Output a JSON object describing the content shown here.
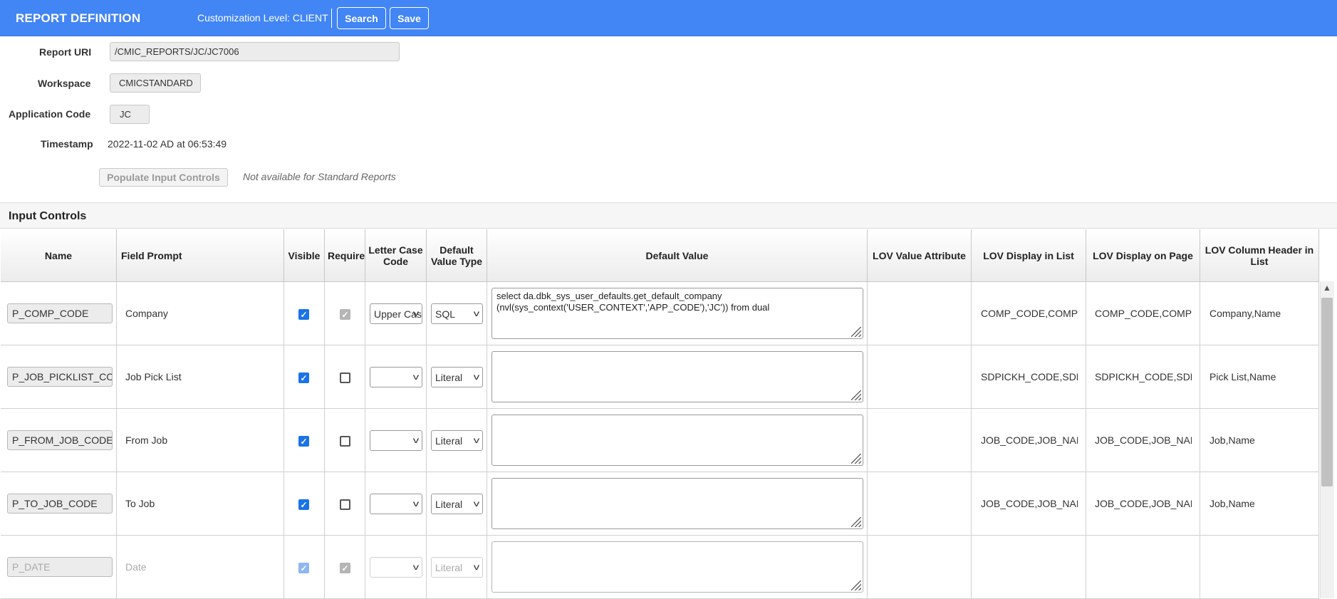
{
  "header": {
    "title": "REPORT DEFINITION",
    "customization_level": "Customization Level: CLIENT",
    "search_label": "Search",
    "save_label": "Save"
  },
  "form": {
    "report_uri_label": "Report URI",
    "report_uri_value": "/CMIC_REPORTS/JC/JC7006",
    "workspace_label": "Workspace",
    "workspace_value": "CMICSTANDARD",
    "application_code_label": "Application Code",
    "application_code_value": "JC",
    "timestamp_label": "Timestamp",
    "timestamp_value": "2022-11-02 AD at 06:53:49",
    "populate_label": "Populate Input Controls",
    "populate_note": "Not available for Standard Reports"
  },
  "section": {
    "title": "Input Controls"
  },
  "grid": {
    "columns": [
      "Name",
      "Field Prompt",
      "Visible",
      "Required",
      "Letter Case Code",
      "Default Value Type",
      "Default Value",
      "LOV Value Attribute",
      "LOV Display in List",
      "LOV Display on Page",
      "LOV Column Header in List"
    ],
    "rows": [
      {
        "name": "P_COMP_CODE",
        "prompt": "Company",
        "visible": "checked",
        "required": "checked-disabled",
        "letter_case": "Upper Case",
        "default_type": "SQL",
        "default_value": "select da.dbk_sys_user_defaults.get_default_company (nvl(sys_context('USER_CONTEXT','APP_CODE'),'JC')) from dual",
        "lov_value_attr": "",
        "lov_display_list": "COMP_CODE,COMP_NAME",
        "lov_display_page": "COMP_CODE,COMP_NAME",
        "lov_column_header": "Company,Name"
      },
      {
        "name": "P_JOB_PICKLIST_CODE",
        "prompt": "Job Pick List",
        "visible": "checked",
        "required": "unchecked",
        "letter_case": "",
        "default_type": "Literal",
        "default_value": "",
        "lov_value_attr": "",
        "lov_display_list": "SDPICKH_CODE,SDPICKH_NAME",
        "lov_display_page": "SDPICKH_CODE,SDPICKH_NAME",
        "lov_column_header": "Pick List,Name"
      },
      {
        "name": "P_FROM_JOB_CODE",
        "prompt": "From Job",
        "visible": "checked",
        "required": "unchecked",
        "letter_case": "",
        "default_type": "Literal",
        "default_value": "",
        "lov_value_attr": "",
        "lov_display_list": "JOB_CODE,JOB_NAME",
        "lov_display_page": "JOB_CODE,JOB_NAME",
        "lov_column_header": "Job,Name"
      },
      {
        "name": "P_TO_JOB_CODE",
        "prompt": "To Job",
        "visible": "checked",
        "required": "unchecked",
        "letter_case": "",
        "default_type": "Literal",
        "default_value": "",
        "lov_value_attr": "",
        "lov_display_list": "JOB_CODE,JOB_NAME",
        "lov_display_page": "JOB_CODE,JOB_NAME",
        "lov_column_header": "Job,Name"
      },
      {
        "name": "P_DATE",
        "prompt": "Date",
        "visible": "checked",
        "required": "checked-disabled",
        "letter_case": "",
        "default_type": "Literal",
        "default_value": "",
        "lov_value_attr": "",
        "lov_display_list": "",
        "lov_display_page": "",
        "lov_column_header": ""
      }
    ]
  },
  "colors": {
    "header_bg": "#4285f4",
    "checkbox_checked": "#1a73e8"
  }
}
